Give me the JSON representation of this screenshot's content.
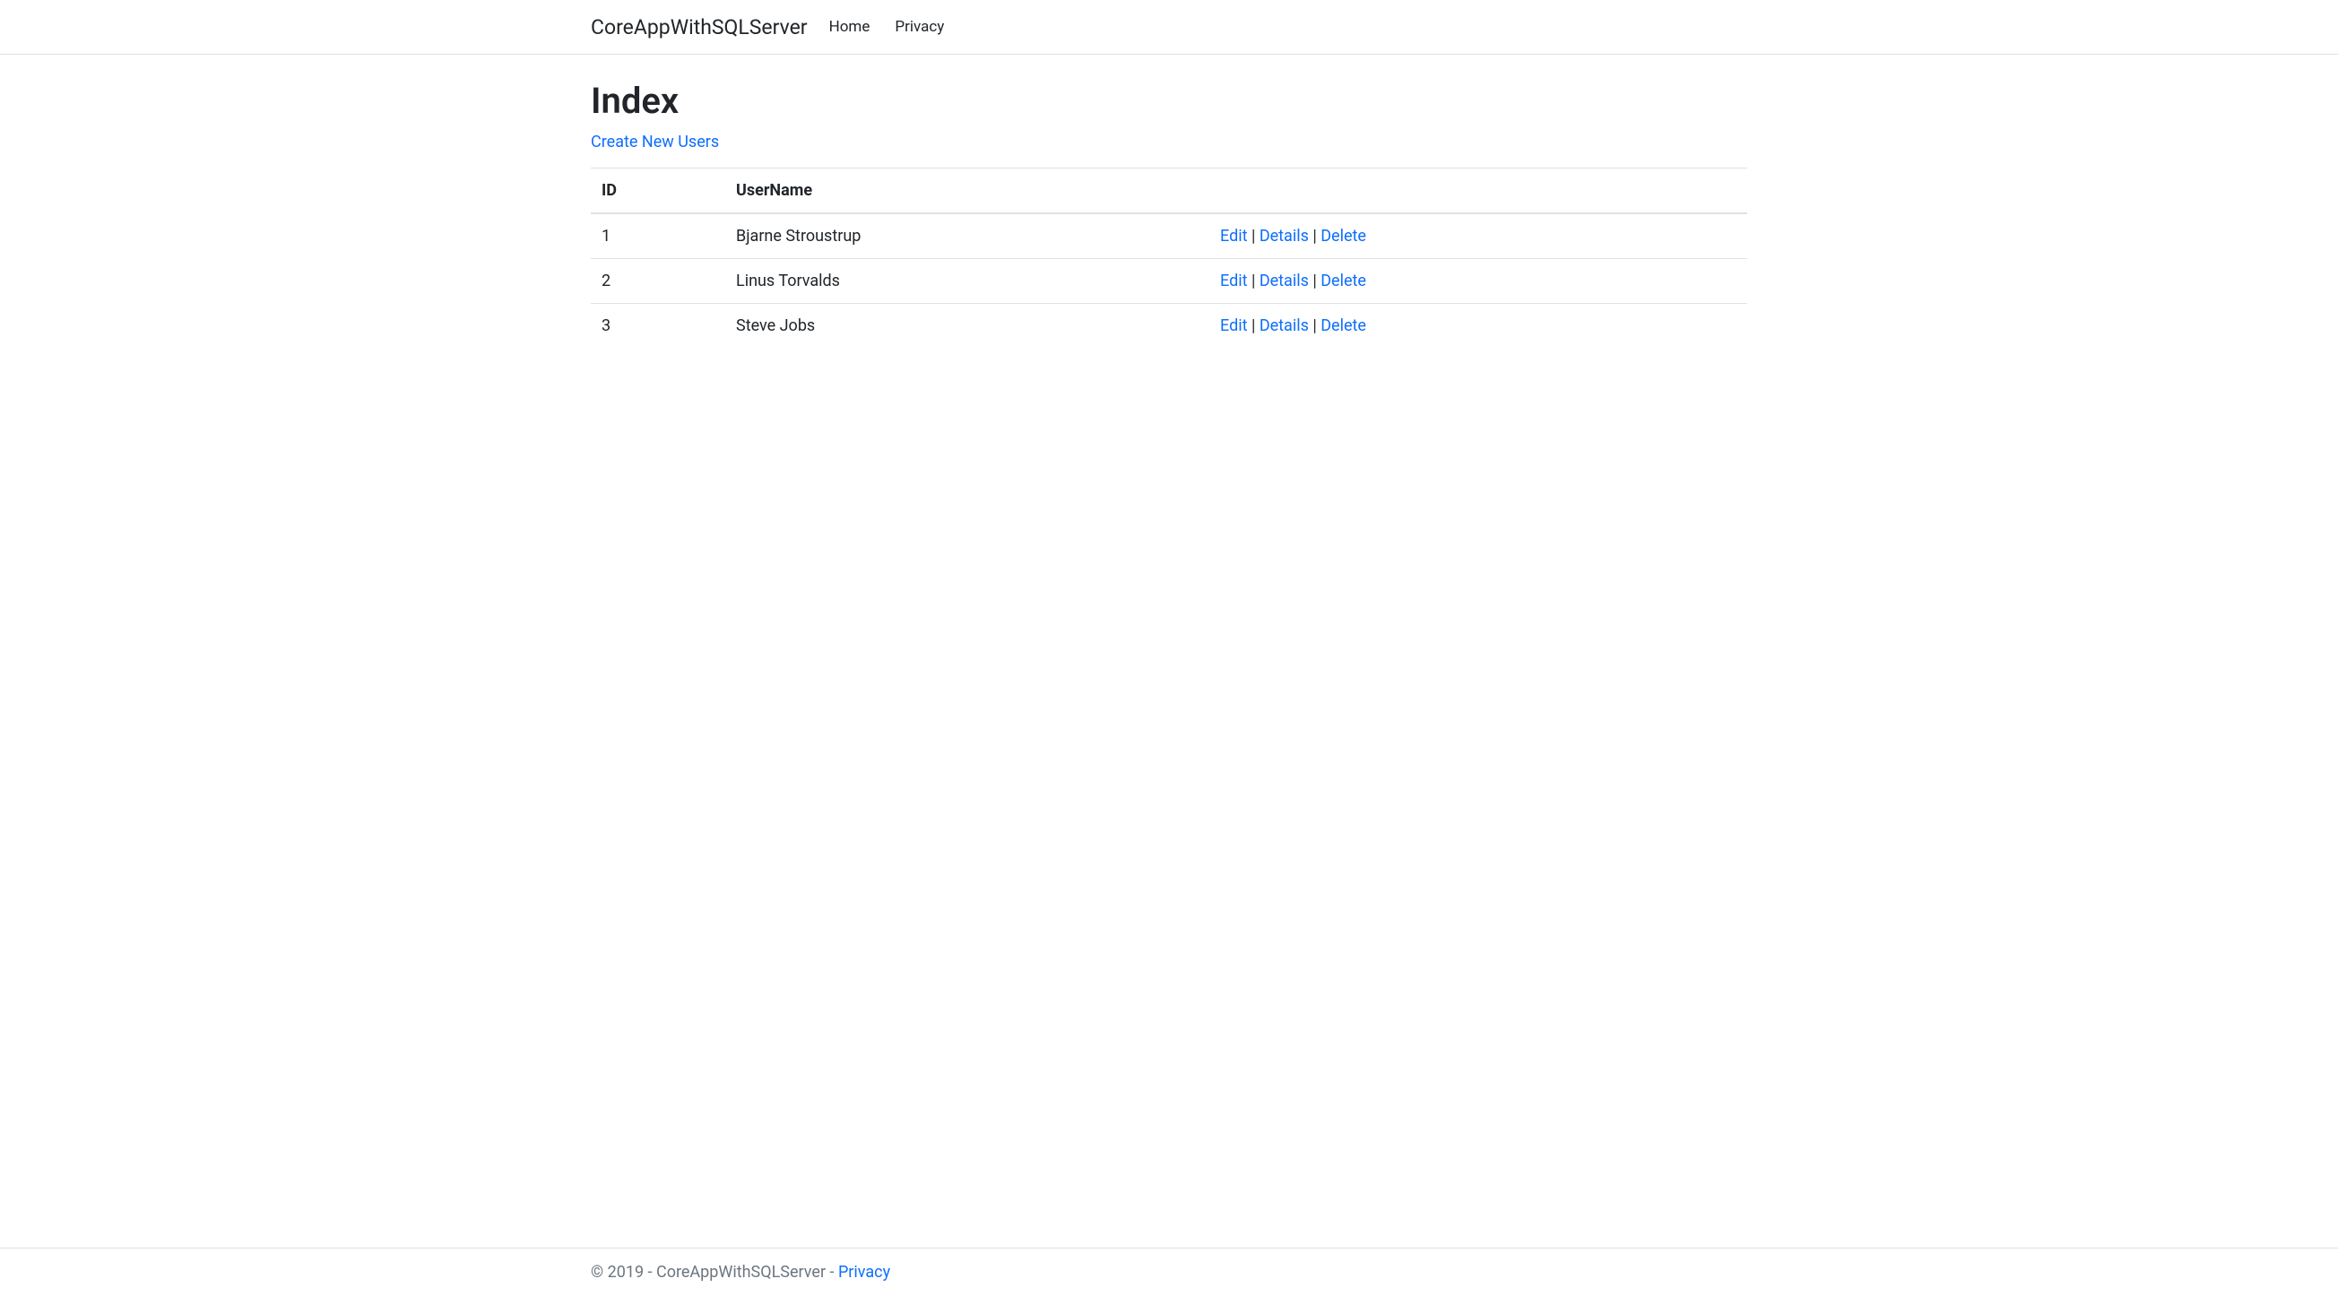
{
  "navbar": {
    "brand": "CoreAppWithSQLServer",
    "links": [
      {
        "label": "Home"
      },
      {
        "label": "Privacy"
      }
    ]
  },
  "page": {
    "title": "Index",
    "create_link": "Create New Users"
  },
  "table": {
    "headers": {
      "id": "ID",
      "username": "UserName",
      "actions": ""
    },
    "rows": [
      {
        "id": "1",
        "username": "Bjarne Stroustrup"
      },
      {
        "id": "2",
        "username": "Linus Torvalds"
      },
      {
        "id": "3",
        "username": "Steve Jobs"
      }
    ],
    "actions": {
      "edit": "Edit",
      "details": "Details",
      "delete": "Delete",
      "sep": " | "
    }
  },
  "footer": {
    "text": "© 2019 - CoreAppWithSQLServer - ",
    "privacy": "Privacy"
  }
}
